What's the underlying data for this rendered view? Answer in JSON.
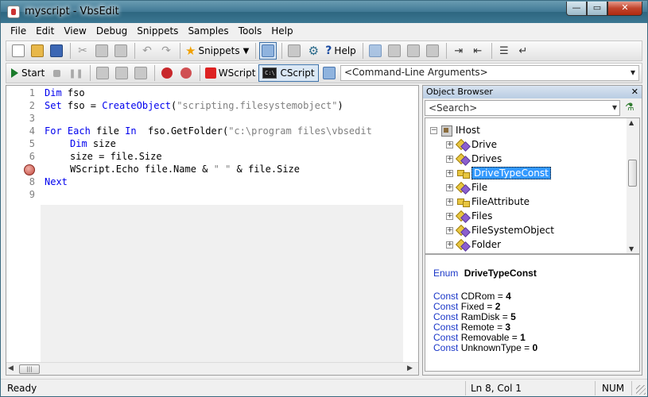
{
  "window": {
    "title": "myscript - VbsEdit"
  },
  "menu": {
    "items": [
      {
        "label": "File"
      },
      {
        "label": "Edit"
      },
      {
        "label": "View"
      },
      {
        "label": "Debug"
      },
      {
        "label": "Snippets"
      },
      {
        "label": "Samples"
      },
      {
        "label": "Tools"
      },
      {
        "label": "Help"
      }
    ]
  },
  "toolbar1": {
    "snippets_label": "Snippets",
    "help_label": "Help"
  },
  "toolbar2": {
    "start_label": "Start",
    "wscript_label": "WScript",
    "cscript_label": "CScript",
    "args_placeholder": "<Command-Line Arguments>",
    "cmd_icon_text": "C:\\"
  },
  "editor": {
    "line_numbers": [
      "1",
      "2",
      "3",
      "4",
      "5",
      "6",
      "7",
      "8",
      "9"
    ],
    "lines": [
      {
        "kw": "Dim",
        "rest": " fso"
      },
      {
        "kw": "Set",
        "rest": " fso = ",
        "fn": "CreateObject",
        "str": "\"scripting.filesystemobject\"",
        "tail": ")"
      },
      {
        "kw": "",
        "rest": ""
      },
      {
        "kw": "For Each",
        "rest": " file ",
        "kw2": "In",
        "rest2": "  fso.GetFolder(",
        "str": "\"c:\\program files\\vbsedit",
        "tail": ""
      },
      {
        "kw": "Dim",
        "rest": " size"
      },
      {
        "kw": "",
        "rest": "size = file.Size"
      },
      {
        "kw": "",
        "rest": "WScript.Echo file.Name & ",
        "str": "\" \"",
        "tail": " & file.Size"
      },
      {
        "kw": "Next",
        "rest": ""
      },
      {
        "kw": "",
        "rest": ""
      }
    ],
    "breakpoint_line": 7
  },
  "object_browser": {
    "title": "Object Browser",
    "search_placeholder": "<Search>",
    "tree": {
      "root": {
        "label": "IHost",
        "icon": "library-icon"
      },
      "items": [
        {
          "label": "Drive",
          "icon": "class-icon"
        },
        {
          "label": "Drives",
          "icon": "class-icon"
        },
        {
          "label": "DriveTypeConst",
          "icon": "enum-icon",
          "selected": true
        },
        {
          "label": "File",
          "icon": "class-icon"
        },
        {
          "label": "FileAttribute",
          "icon": "enum-icon"
        },
        {
          "label": "Files",
          "icon": "class-icon"
        },
        {
          "label": "FileSystemObject",
          "icon": "class-icon"
        },
        {
          "label": "Folder",
          "icon": "class-icon"
        }
      ]
    },
    "details": {
      "enum_keyword": "Enum",
      "enum_name": "DriveTypeConst",
      "const_keyword": "Const",
      "constants": [
        {
          "name": "CDRom",
          "value": "4"
        },
        {
          "name": "Fixed",
          "value": "2"
        },
        {
          "name": "RamDisk",
          "value": "5"
        },
        {
          "name": "Remote",
          "value": "3"
        },
        {
          "name": "Removable",
          "value": "1"
        },
        {
          "name": "UnknownType",
          "value": "0"
        }
      ]
    }
  },
  "statusbar": {
    "status": "Ready",
    "position": "Ln 8, Col 1",
    "num": "NUM"
  },
  "colors": {
    "keyword": "#0000ee",
    "string": "#7f7f7f",
    "selection": "#3399ff"
  }
}
